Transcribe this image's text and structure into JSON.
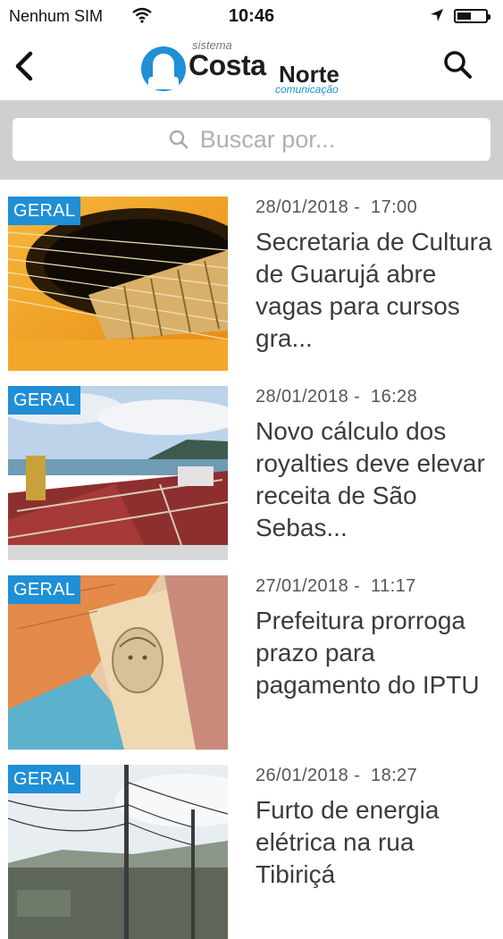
{
  "status_bar": {
    "carrier": "Nenhum SIM",
    "time": "10:46"
  },
  "brand": {
    "top": "sistema",
    "costa": "Costa",
    "norte": "Norte",
    "bottom": "comunicação"
  },
  "search": {
    "placeholder": "Buscar por..."
  },
  "colors": {
    "accent": "#1f8fd6",
    "search_bg": "#cfcfcf"
  },
  "news": [
    {
      "tag": "GERAL",
      "date": "28/01/2018",
      "time": "17:00",
      "title": "Secretaria de Cultura de Guarujá abre vagas para cursos gra...",
      "image": "guitar"
    },
    {
      "tag": "GERAL",
      "date": "28/01/2018",
      "time": "16:28",
      "title": "Novo cálculo dos royalties deve elevar receita de São Sebas...",
      "image": "ships"
    },
    {
      "tag": "GERAL",
      "date": "27/01/2018",
      "time": "11:17",
      "title": "Prefeitura prorroga prazo para pagamento do IPTU",
      "image": "banknotes"
    },
    {
      "tag": "GERAL",
      "date": "26/01/2018",
      "time": "18:27",
      "title": "Furto de energia elétrica na rua Tibiriçá",
      "image": "power-lines"
    }
  ]
}
